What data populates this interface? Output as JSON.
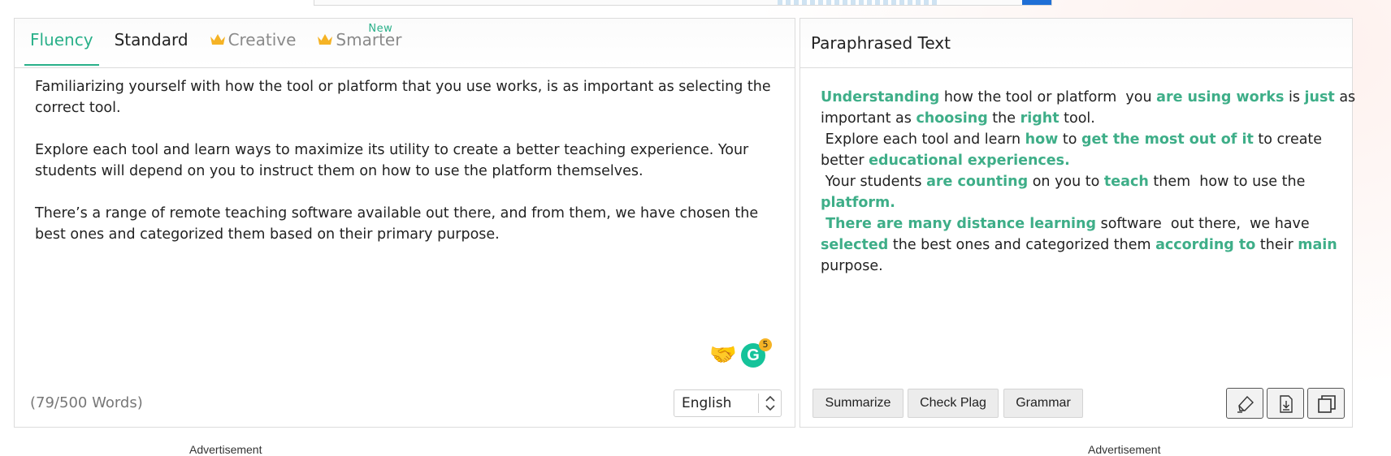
{
  "tabs": [
    {
      "label": "Fluency",
      "active": true,
      "premium": false
    },
    {
      "label": "Standard",
      "active": false,
      "premium": false
    },
    {
      "label": "Creative",
      "active": false,
      "premium": true
    },
    {
      "label": "Smarter",
      "active": false,
      "premium": true,
      "badge": "New"
    }
  ],
  "input": {
    "paragraphs": [
      "Familiarizing yourself with how the tool or platform that you use works, is as important as selecting the correct tool.",
      "Explore each tool and learn ways to maximize its utility to create a better teaching experience.  Your students will depend on you to instruct them on how to use the platform themselves.",
      "There’s a range of remote teaching software available out there, and from them, we have chosen the best ones and categorized them based on their primary purpose."
    ],
    "word_count": "(79/500 Words)",
    "language": "English",
    "grammarly_count": "5",
    "grammarly_letter": "G",
    "emoji": "🤝"
  },
  "output": {
    "title": "Paraphrased Text",
    "lines": [
      [
        [
          "Understanding",
          true
        ],
        [
          " how the tool or platform  you ",
          false
        ],
        [
          "are using works",
          true
        ],
        [
          " is ",
          false
        ],
        [
          "just",
          true
        ],
        [
          " as",
          false
        ]
      ],
      [
        [
          "important as ",
          false
        ],
        [
          "choosing",
          true
        ],
        [
          " the ",
          false
        ],
        [
          "right",
          true
        ],
        [
          " tool.",
          false
        ]
      ],
      [
        [
          " Explore each tool and learn ",
          false
        ],
        [
          "how",
          true
        ],
        [
          " to ",
          false
        ],
        [
          "get the most out of it",
          true
        ],
        [
          " to create",
          false
        ]
      ],
      [
        [
          "better ",
          false
        ],
        [
          "educational experiences.",
          true
        ]
      ],
      [
        [
          " Your students ",
          false
        ],
        [
          "are counting",
          true
        ],
        [
          " on you to ",
          false
        ],
        [
          "teach",
          true
        ],
        [
          " them  how to use the",
          false
        ]
      ],
      [
        [
          "platform.",
          true
        ]
      ],
      [
        [
          " There are many distance learning",
          true
        ],
        [
          " software  out there,  we have",
          false
        ]
      ],
      [
        [
          "selected",
          true
        ],
        [
          " the best ones and categorized them ",
          false
        ],
        [
          "according to",
          true
        ],
        [
          " their ",
          false
        ],
        [
          "main",
          true
        ]
      ],
      [
        [
          "purpose.",
          false
        ]
      ]
    ],
    "buttons": {
      "summarize": "Summarize",
      "check_plag": "Check Plag",
      "grammar": "Grammar"
    }
  },
  "ads": {
    "left": "Advertisement",
    "right": "Advertisement"
  },
  "colors": {
    "accent": "#29b089",
    "highlight": "#3eae88",
    "crown": "#f5b325"
  }
}
